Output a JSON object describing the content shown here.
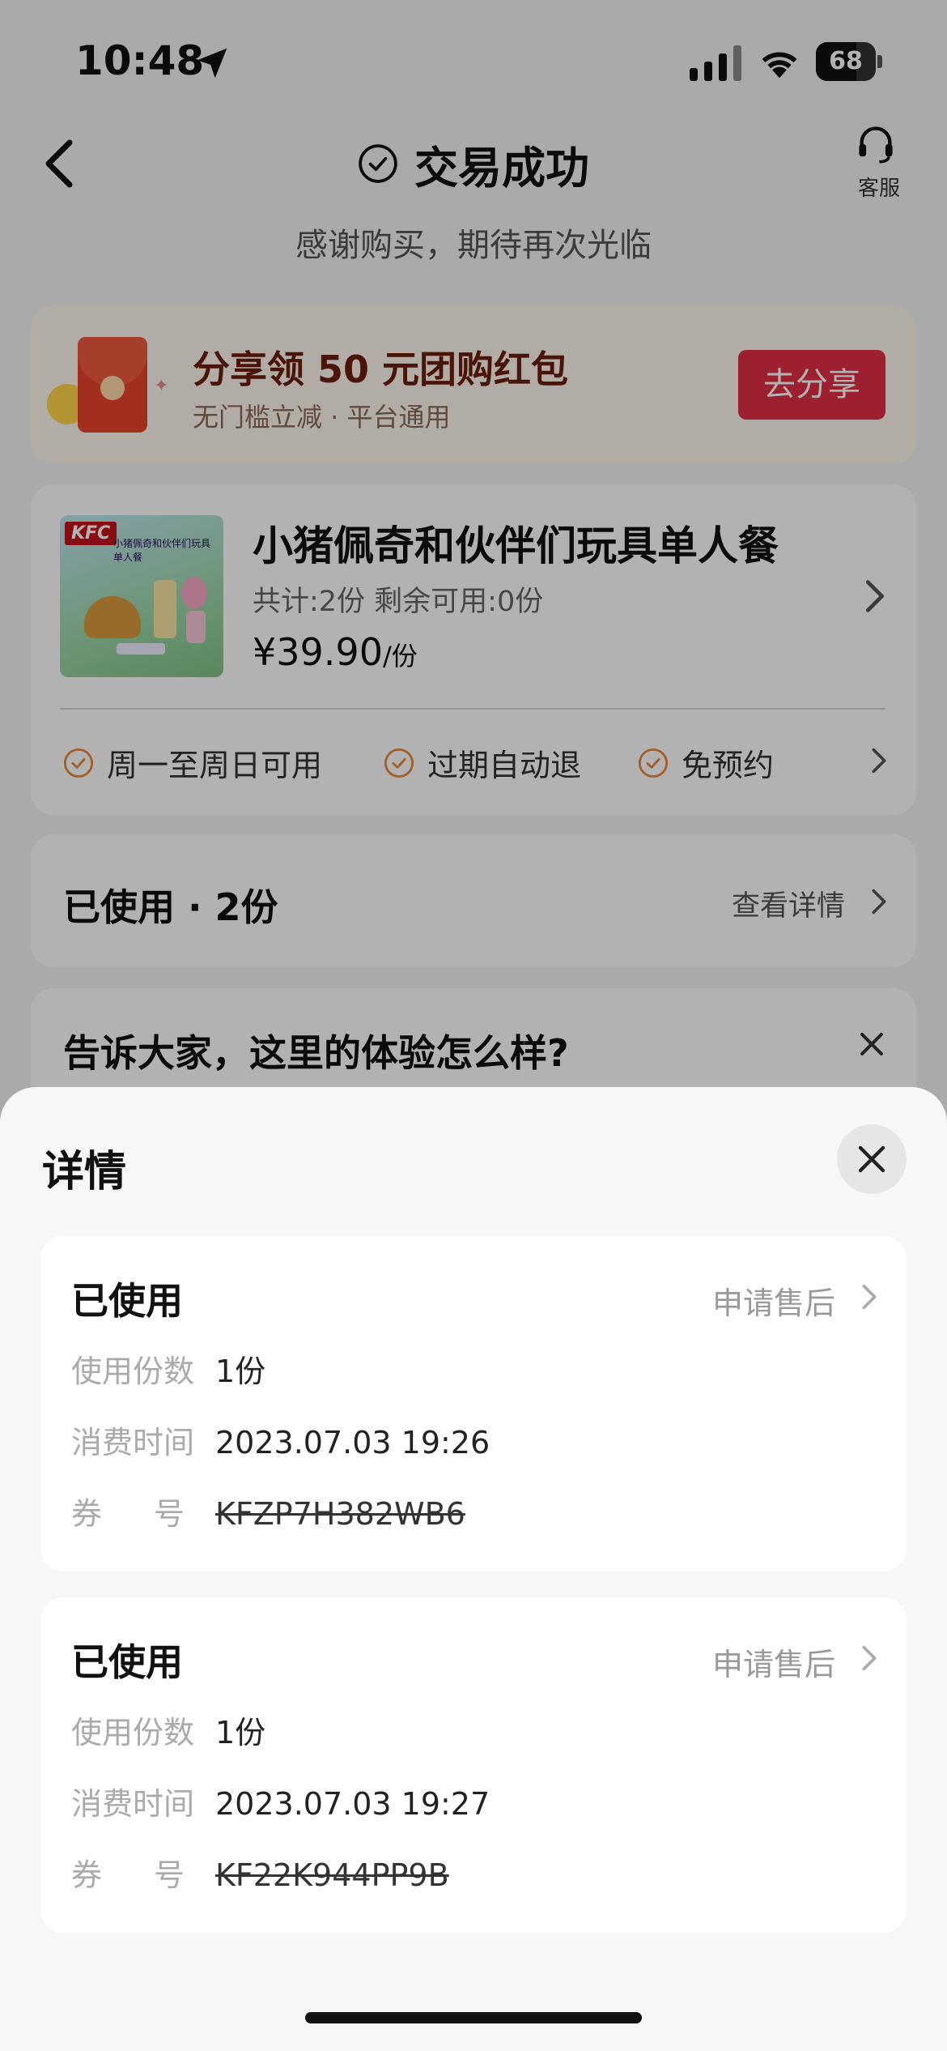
{
  "status_bar": {
    "time": "10:48",
    "battery": "68",
    "battery_level": 0.68
  },
  "header": {
    "title": "交易成功",
    "customer_service_label": "客服",
    "subtitle": "感谢购买，期待再次光临"
  },
  "promo": {
    "title": "分享领 50 元团购红包",
    "subtitle": "无门槛立减 · 平台通用",
    "button_label": "去分享"
  },
  "product": {
    "thumb_brand": "KFC",
    "thumb_title": "小猪佩奇和伙伴们玩具单人餐",
    "name": "小猪佩奇和伙伴们玩具单人餐",
    "count_text": "共计:2份  剩余可用:0份",
    "price": "¥39.90",
    "price_unit": "/份",
    "features": [
      "周一至周日可用",
      "过期自动退",
      "免预约"
    ]
  },
  "used_summary": {
    "title": "已使用 · 2份",
    "link_label": "查看详情"
  },
  "review": {
    "title": "告诉大家，这里的体验怎么样?"
  },
  "sheet": {
    "title": "详情",
    "records": [
      {
        "status": "已使用",
        "after_sale_label": "申请售后",
        "count_label": "使用份数",
        "count_value": "1份",
        "time_label": "消费时间",
        "time_value": "2023.07.03 19:26",
        "code_label_a": "券",
        "code_label_b": "号",
        "code_value": "KFZP7H382WB6"
      },
      {
        "status": "已使用",
        "after_sale_label": "申请售后",
        "count_label": "使用份数",
        "count_value": "1份",
        "time_label": "消费时间",
        "time_value": "2023.07.03 19:27",
        "code_label_a": "券",
        "code_label_b": "号",
        "code_value": "KF22K944PP9B"
      }
    ]
  },
  "colors": {
    "accent_red": "#e02e44",
    "feature_orange": "#e8883a",
    "sheet_bg": "#f7f7f7"
  }
}
